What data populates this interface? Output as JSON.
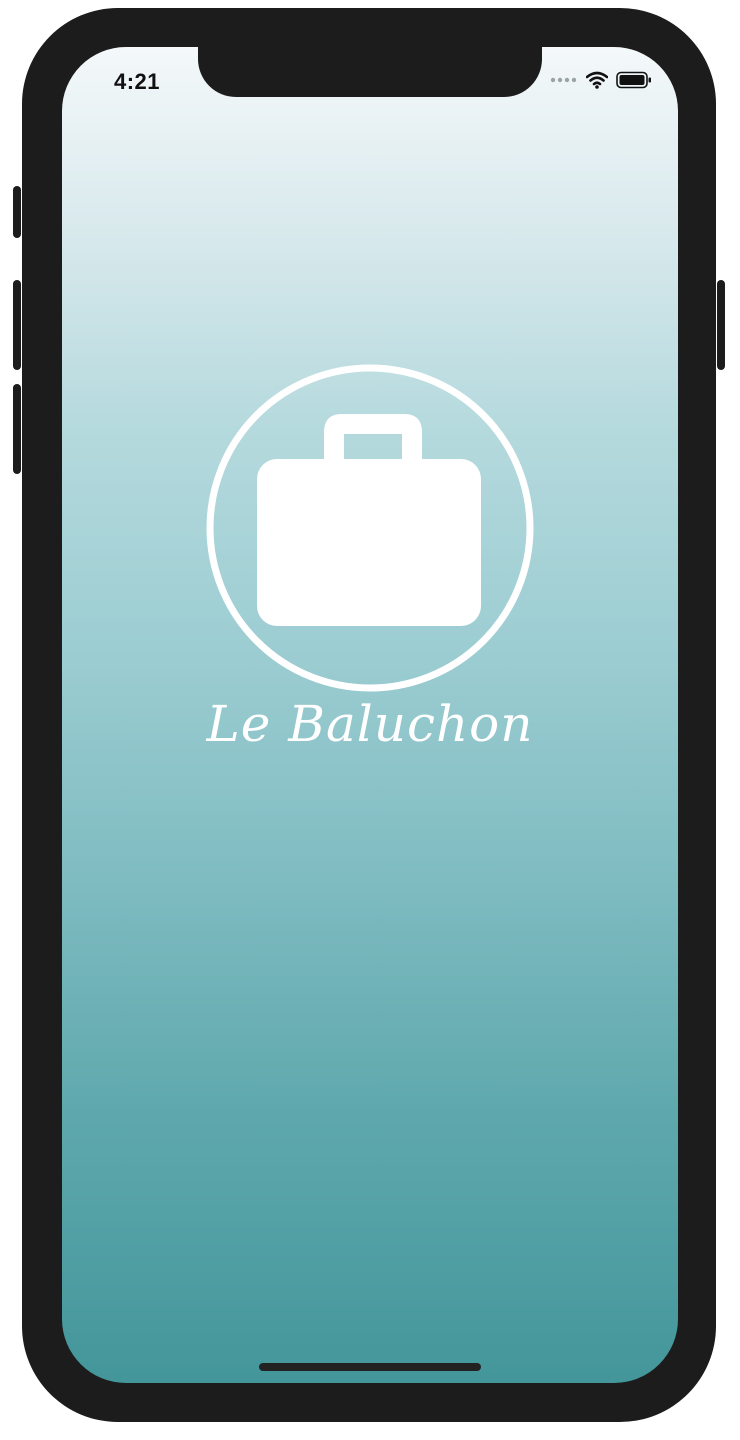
{
  "status_bar": {
    "time": "4:21",
    "signal_icon": "signal-dots-icon",
    "wifi_icon": "wifi-icon",
    "battery_icon": "battery-icon"
  },
  "splash": {
    "logo_icon": "suitcase-icon",
    "app_name": "Le Baluchon"
  },
  "colors": {
    "gradient_top": "#f4f8fa",
    "gradient_bottom": "#43969a",
    "logo": "#ffffff"
  }
}
